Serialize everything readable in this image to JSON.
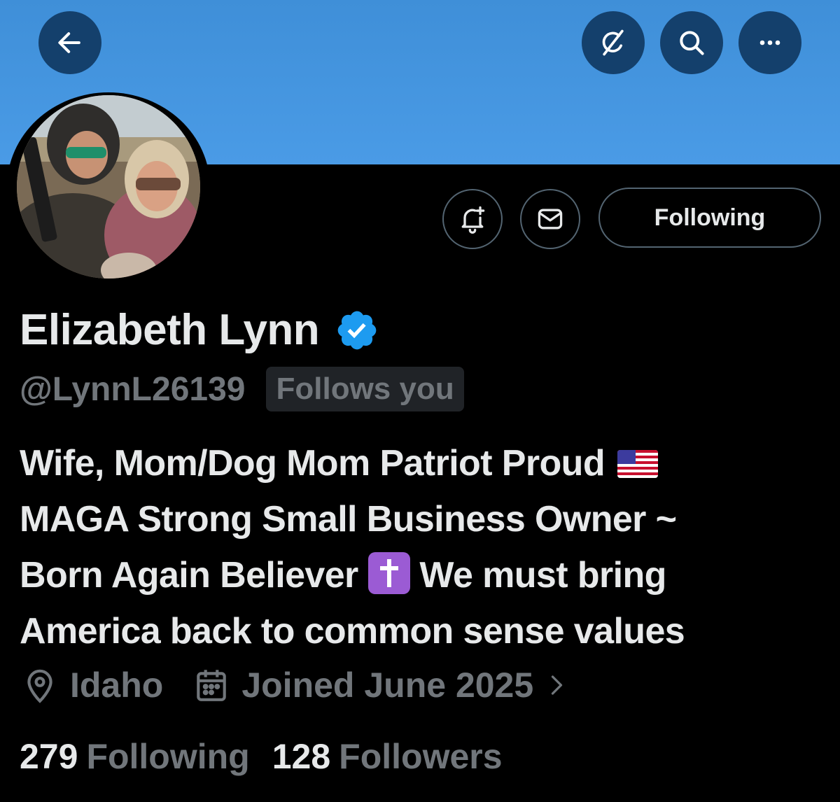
{
  "header": {
    "icons": [
      "back-arrow-icon",
      "grok-icon",
      "search-icon",
      "more-icon"
    ],
    "banner_color": "#4a9be6"
  },
  "actions": {
    "following_label": "Following"
  },
  "profile": {
    "name": "Elizabeth Lynn",
    "handle": "@LynnL26139",
    "follows_you": "Follows you",
    "bio": {
      "line1": "Wife, Mom/Dog Mom Patriot Proud",
      "line2": "MAGA Strong Small Business Owner ~",
      "line3a": "Born Again Believer",
      "line3b": "We must bring",
      "line4": "America back to common sense values"
    },
    "location": "Idaho",
    "joined": "Joined June 2025"
  },
  "stats": {
    "following_count": "279",
    "following_label": "Following",
    "followers_count": "128",
    "followers_label": "Followers"
  },
  "colors": {
    "verified": "#1d9bf0",
    "secondary_text": "#71767b",
    "nav_button": "#14406c"
  }
}
